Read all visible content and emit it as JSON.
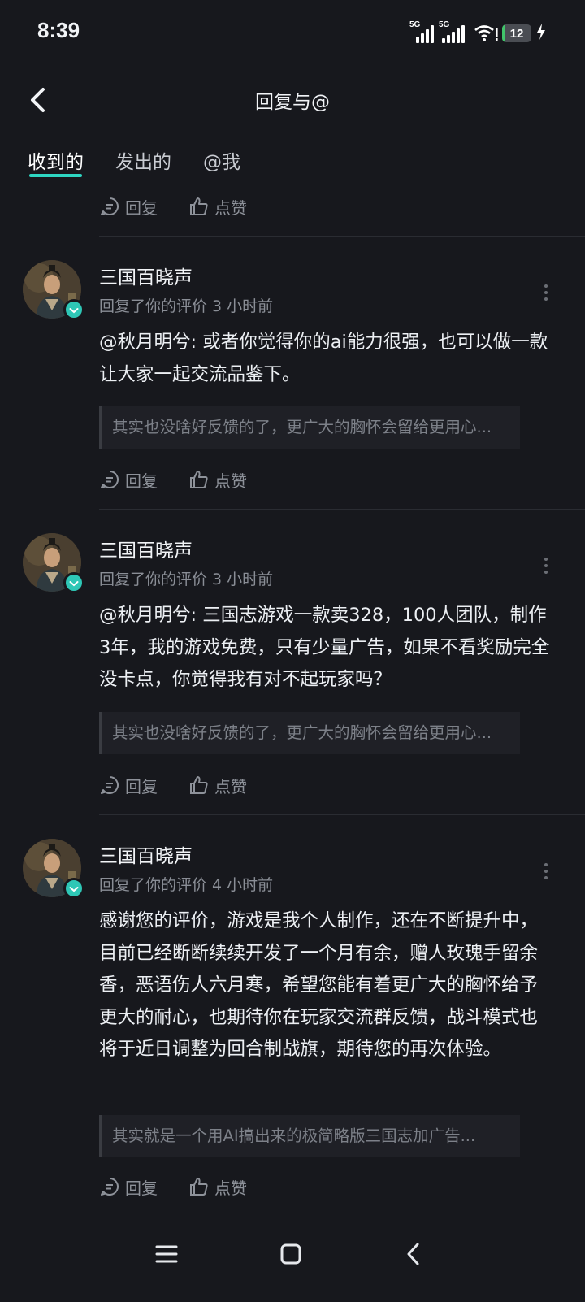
{
  "status_bar": {
    "time": "8:39",
    "network1": "5G",
    "network2": "5G",
    "battery": "12",
    "battery_level": 0.12,
    "charging_icon": "bolt-icon"
  },
  "header": {
    "title": "回复与@",
    "back_icon": "chevron-left-icon"
  },
  "tabs": [
    {
      "label": "收到的",
      "active": true
    },
    {
      "label": "发出的",
      "active": false
    },
    {
      "label": "@我",
      "active": false
    }
  ],
  "actions": {
    "reply": "回复",
    "like": "点赞"
  },
  "comments": [
    {
      "author": "三国百晓声",
      "meta": "回复了你的评价 3 小时前",
      "content": "@秋月明兮: 或者你觉得你的ai能力很强，也可以做一款让大家一起交流品鉴下。",
      "quote": "其实也没啥好反馈的了，更广大的胸怀会留给更用心..."
    },
    {
      "author": "三国百晓声",
      "meta": "回复了你的评价 3 小时前",
      "content": "@秋月明兮: 三国志游戏一款卖328，100人团队，制作3年，我的游戏免费，只有少量广告，如果不看奖励完全没卡点，你觉得我有对不起玩家吗？",
      "quote": "其实也没啥好反馈的了，更广大的胸怀会留给更用心..."
    },
    {
      "author": "三国百晓声",
      "meta": "回复了你的评价 4 小时前",
      "content": "感谢您的评价，游戏是我个人制作，还在不断提升中，目前已经断断续续开发了一个月有余，赠人玫瑰手留余香，恶语伤人六月寒，希望您能有着更广大的胸怀给予更大的耐心，也期待你在玩家交流群反馈，战斗模式也将于近日调整为回合制战旗，期待您的再次体验。",
      "quote": "其实就是一个用AI搞出来的极简略版三国志加广告..."
    }
  ],
  "nav": {
    "menu_icon": "menu-icon",
    "home_icon": "home-square-icon",
    "back_icon": "back-chevron-icon"
  },
  "colors": {
    "background": "#17181d",
    "accent": "#2ed6c2",
    "verified": "#2ec7b6",
    "battery": "#41c46a"
  }
}
